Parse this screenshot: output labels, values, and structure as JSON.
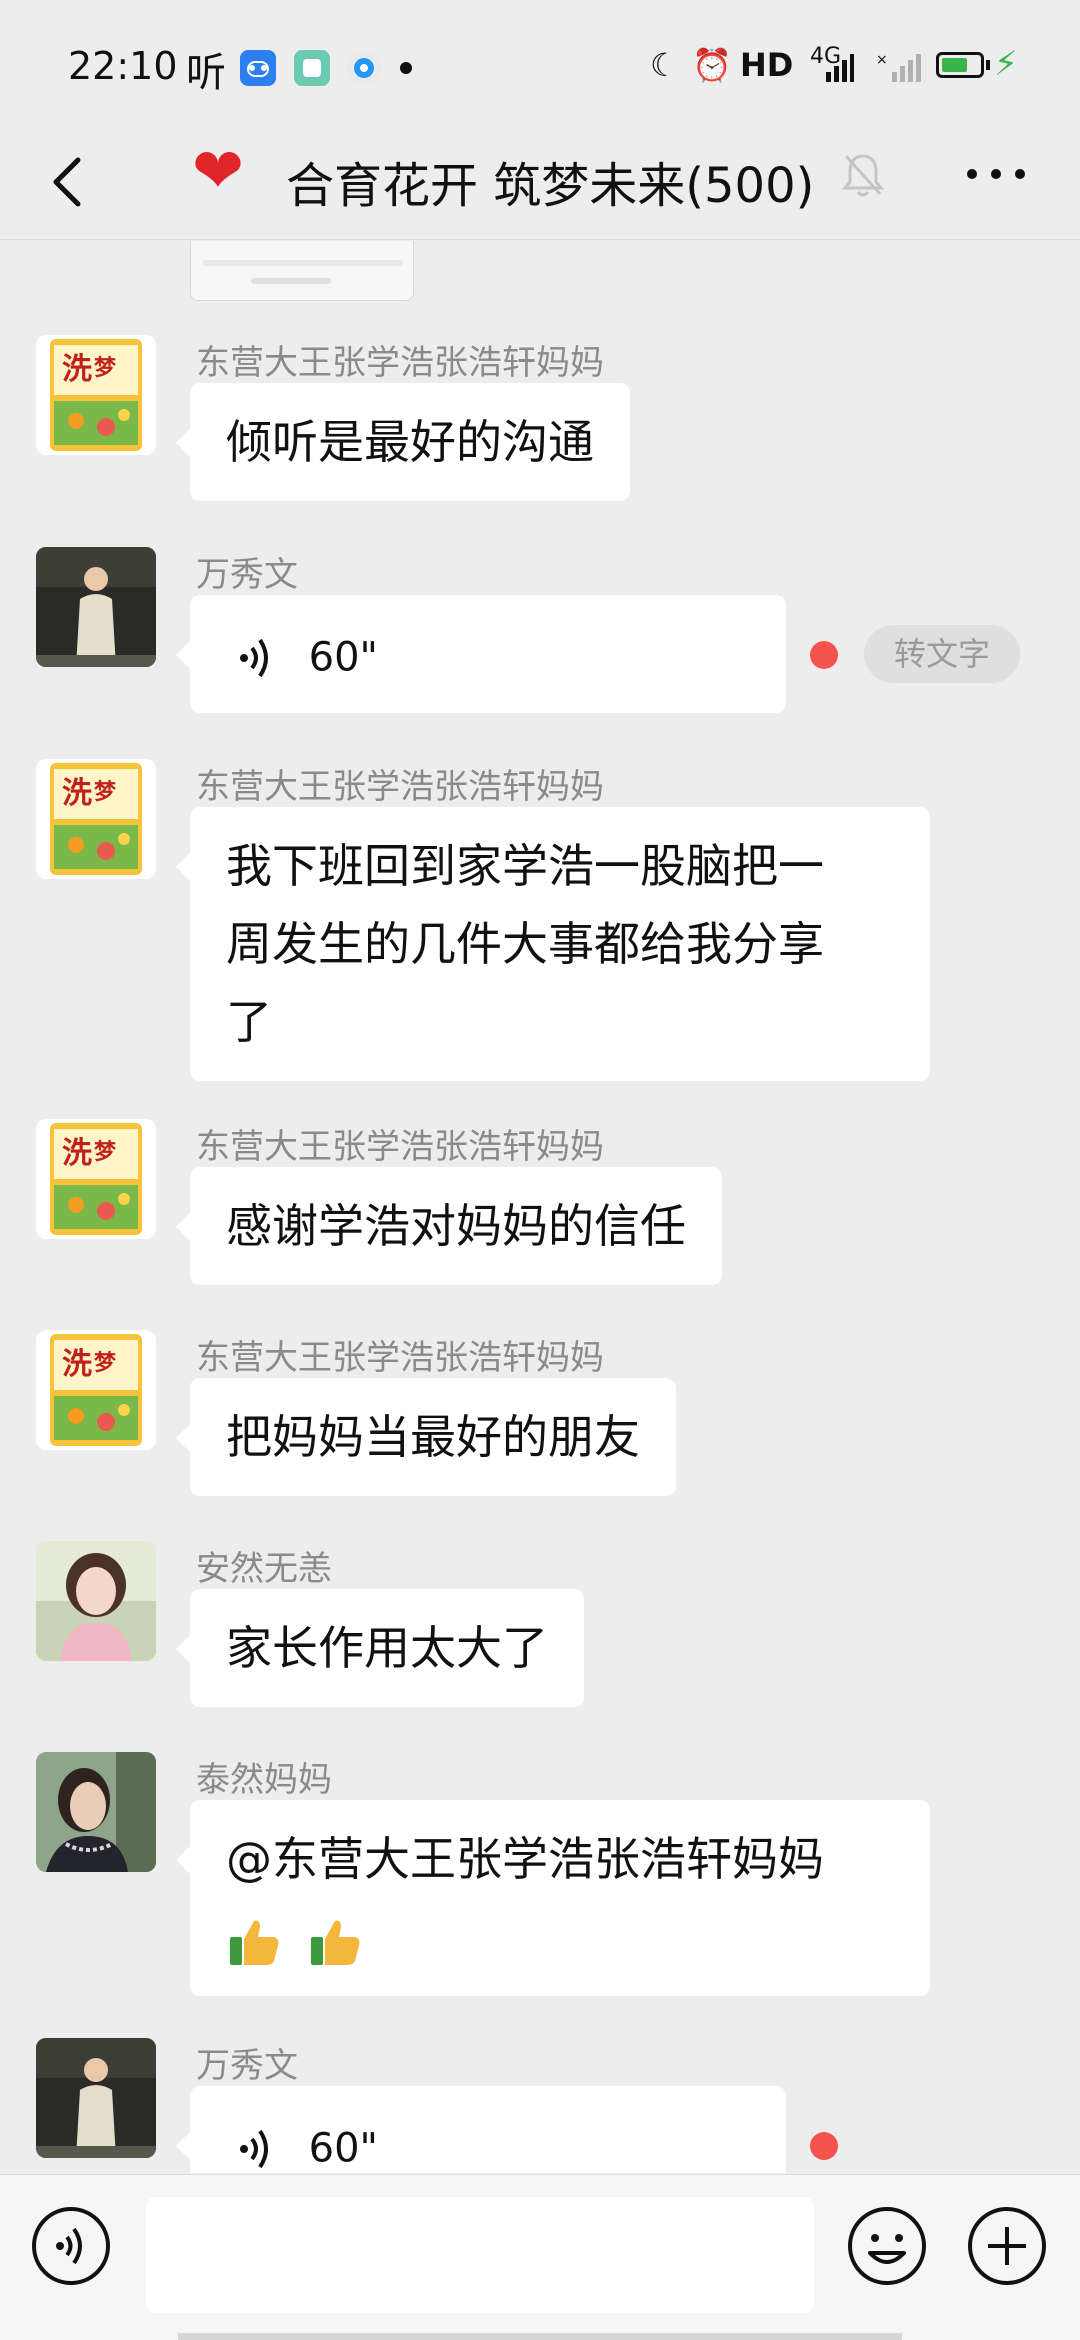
{
  "status_bar": {
    "time": "22:10",
    "ting": "听",
    "network": "HD",
    "net_type": "4G",
    "battery_level": 0.7,
    "accent": "#3bb54a"
  },
  "header": {
    "title": "合育花开 筑梦未来(500)",
    "back_icon": "chevron-left-icon",
    "mute_icon": "bell-off-icon",
    "more_icon": "ellipsis-icon"
  },
  "messages": [
    {
      "sender": "东营大王张学浩张浩轩妈妈",
      "text": "倾听是最好的沟通",
      "avatar": "flour-bag"
    },
    {
      "sender": "万秀文",
      "voice_length": "60\"",
      "to_text": "转文字",
      "unread": true,
      "avatar": "person-coat"
    },
    {
      "sender": "东营大王张学浩张浩轩妈妈",
      "text_lines": [
        "我下班回到家学浩一股脑把一",
        "周发生的几件大事都给我分享",
        "了"
      ],
      "avatar": "flour-bag"
    },
    {
      "sender": "东营大王张学浩张浩轩妈妈",
      "text": "感谢学浩对妈妈的信任",
      "avatar": "flour-bag"
    },
    {
      "sender": "东营大王张学浩张浩轩妈妈",
      "text": "把妈妈当最好的朋友",
      "avatar": "flour-bag"
    },
    {
      "sender": "安然无恙",
      "text": "家长作用太大了",
      "avatar": "girl-pink"
    },
    {
      "sender": "泰然妈妈",
      "text": "@东营大王张学浩张浩轩妈妈",
      "emoji": "thumbs-up x2",
      "avatar": "woman-profile"
    },
    {
      "sender": "万秀文",
      "voice_length": "60\"",
      "unread": true,
      "avatar": "person-coat"
    }
  ],
  "input_bar": {
    "voice_icon": "voice-input-icon",
    "emoji_icon": "emoji-icon",
    "plus_icon": "plus-icon"
  },
  "colors": {
    "background": "#ededed",
    "bubble": "#ffffff",
    "unread": "#f5534f",
    "sender": "#8a8a8a"
  }
}
